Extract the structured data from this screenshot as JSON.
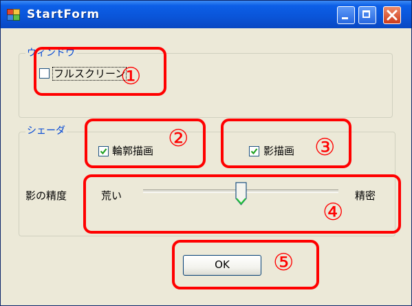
{
  "window": {
    "title": "StartForm",
    "controls": [
      "minimize-icon",
      "maximize-icon",
      "close-icon"
    ]
  },
  "groups": {
    "window_group": {
      "label": "ウィンドウ",
      "fullscreen": {
        "label": "フルスクリーン",
        "checked": false
      }
    },
    "shader_group": {
      "label": "シェーダ",
      "outline": {
        "label": "輪郭描画",
        "checked": true
      },
      "shadow": {
        "label": "影描画",
        "checked": true
      },
      "shadow_precision": {
        "label": "影の精度",
        "min_label": "荒い",
        "max_label": "精密",
        "value_fraction": 0.5
      }
    }
  },
  "ok_button": {
    "label": "OK"
  },
  "annotations": [
    "①",
    "②",
    "③",
    "④",
    "⑤"
  ],
  "colors": {
    "annotation": "#ff0000",
    "titlebar": "#0a54d8",
    "group_label": "#0046d5",
    "check": "#21a121"
  }
}
